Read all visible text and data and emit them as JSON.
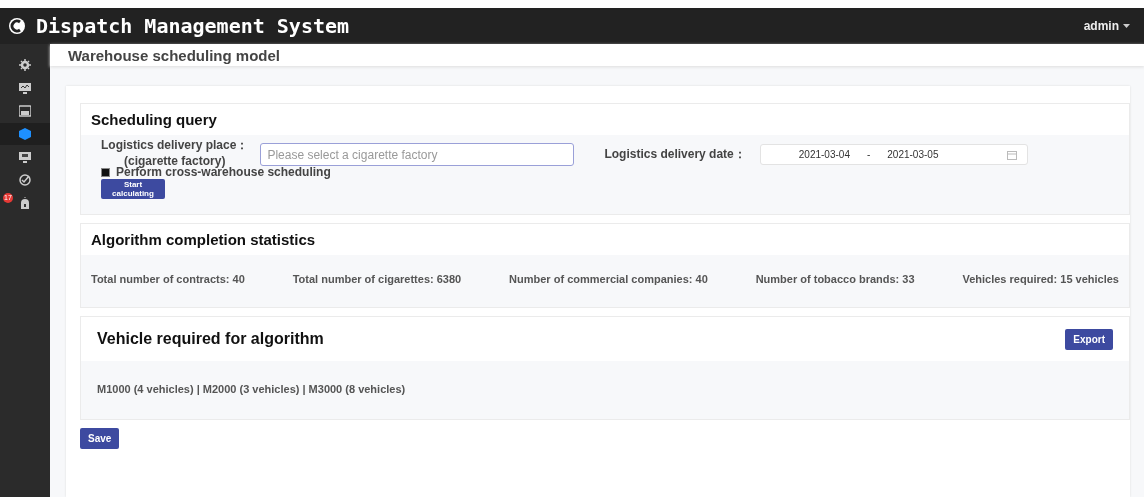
{
  "header": {
    "title": "Dispatch Management System",
    "user": "admin"
  },
  "sidebar": {
    "items": [
      {
        "selected": false
      },
      {
        "selected": false
      },
      {
        "selected": false
      },
      {
        "selected": true
      },
      {
        "selected": false
      },
      {
        "selected": false
      },
      {
        "selected": false,
        "badge": "17"
      }
    ]
  },
  "page_title": "Warehouse scheduling model",
  "query": {
    "title": "Scheduling query",
    "place_label": "Logistics delivery place：",
    "place_label_2": "(cigarette factory)",
    "place": {
      "placeholder": "Please select a cigarette factory"
    },
    "date_label": "Logistics delivery date：",
    "date_from": "2021-03-04",
    "date_sep": "-",
    "date_to": "2021-03-05",
    "cross_warehouse": {
      "label": "Perform cross-warehouse scheduling",
      "checked": true
    },
    "button": "Start calculating"
  },
  "statistics": {
    "title": "Algorithm completion statistics",
    "items": [
      "Total number of contracts: 40",
      "Total number of cigarettes: 6380",
      "Number of commercial companies: 40",
      "Number of tobacco brands: 33",
      "Vehicles required: 15 vehicles"
    ]
  },
  "vehicles": {
    "title": "Vehicle required for algorithm",
    "export": "Export",
    "summary": "M1000 (4 vehicles) | M2000 (3 vehicles) | M3000 (8 vehicles)"
  },
  "save": "Save"
}
